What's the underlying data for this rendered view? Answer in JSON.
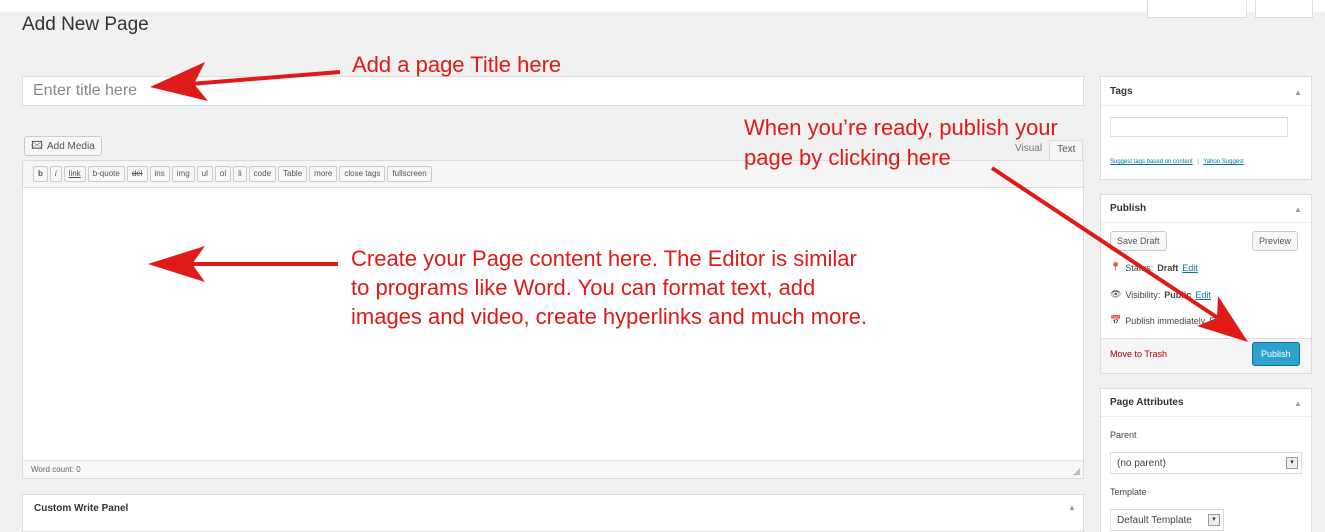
{
  "header": {
    "title": "Add New Page"
  },
  "title_field": {
    "placeholder": "Enter title here"
  },
  "editor": {
    "add_media": "Add Media",
    "tabs": [
      "Visual",
      "Text"
    ],
    "quicktags": [
      "b",
      "i",
      "link",
      "b-quote",
      "del",
      "ins",
      "img",
      "ul",
      "ol",
      "li",
      "code",
      "Table",
      "more",
      "close tags",
      "fullscreen"
    ],
    "word_count": "Word count: 0"
  },
  "custom_panel": {
    "title": "Custom Write Panel"
  },
  "tags_box": {
    "title": "Tags",
    "link_a": "Suggest tags based on content",
    "link_sep": "|",
    "link_b": "Yahoo Suggest"
  },
  "publish_box": {
    "title": "Publish",
    "save_draft": "Save Draft",
    "preview": "Preview",
    "status_label": "Status:",
    "status_value": "Draft",
    "visibility_label": "Visibility:",
    "visibility_value": "Public",
    "schedule": "Publish immediately",
    "edit": "Edit",
    "trash": "Move to Trash",
    "publish": "Publish"
  },
  "attributes_box": {
    "title": "Page Attributes",
    "parent_label": "Parent",
    "parent_value": "(no parent)",
    "template_label": "Template",
    "template_value": "Default Template"
  },
  "annotations": {
    "title_note": "Add a page Title here",
    "publish_note_1": "When you’re ready, publish your",
    "publish_note_2": "page by clicking here",
    "content_note_1": "Create your Page content here. The Editor is similar",
    "content_note_2": "to programs like Word. You can format text, add",
    "content_note_3": "images and video, create hyperlinks and much more.",
    "color": "#e01919"
  },
  "colors": {
    "background": "#f1f1f1",
    "primary_button": "#2ea2cc",
    "link": "#0074a2",
    "trash": "#aa0000"
  }
}
